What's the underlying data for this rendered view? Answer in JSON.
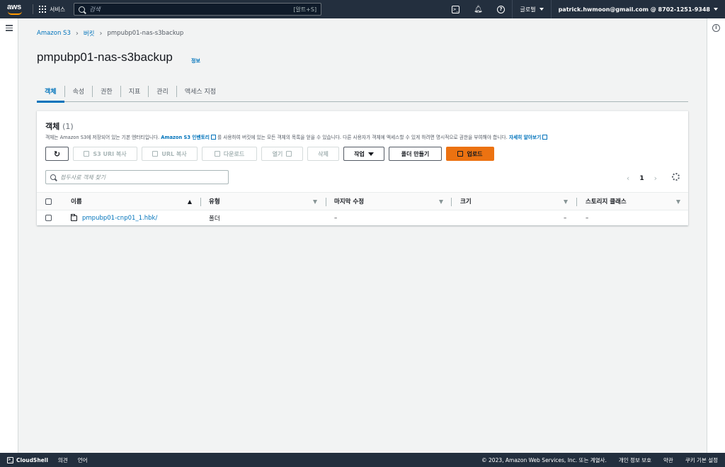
{
  "topnav": {
    "logo": "aws",
    "services_label": "서비스",
    "search_placeholder": "검색",
    "search_shortcut": "[알트+S]",
    "region_label": "글로벌",
    "account_label": "patrick.hwmoon@gmail.com @ 8702-1251-9348",
    "icons": [
      "grid-icon",
      "search-icon",
      "cloudshell-icon",
      "bell-icon",
      "help-icon"
    ]
  },
  "breadcrumb": {
    "items": [
      "Amazon S3",
      "버킷",
      "pmpubp01-nas-s3backup"
    ]
  },
  "page": {
    "title": "pmpubp01-nas-s3backup",
    "info_link": "정보"
  },
  "tabs": [
    {
      "label": "객체",
      "active": true
    },
    {
      "label": "속성",
      "active": false
    },
    {
      "label": "권한",
      "active": false
    },
    {
      "label": "지표",
      "active": false
    },
    {
      "label": "관리",
      "active": false
    },
    {
      "label": "액세스 지점",
      "active": false
    }
  ],
  "objects_panel": {
    "heading": "객체",
    "count": "(1)",
    "desc_1": "객체는 Amazon S3에 저장되어 있는 기본 엔터티입니다.",
    "desc_link_1": "Amazon S3 인벤토리",
    "desc_2": "를 사용하여 버킷에 있는 모든 객체의 목록을 얻을 수 있습니다. 다른 사용자가 객체에 액세스할 수 있게 하려면 명시적으로 권한을 부여해야 합니다.",
    "desc_link_2": "자세히 알아보기",
    "buttons": {
      "copy_s3_uri": "S3 URI 복사",
      "copy_url": "URL 복사",
      "download": "다운로드",
      "open": "열기",
      "delete": "삭제",
      "actions": "작업",
      "create_folder": "폴더 만들기",
      "upload": "업로드"
    },
    "filter_placeholder": "접두사로 객체 찾기",
    "page_number": "1",
    "columns": [
      "이름",
      "유형",
      "마지막 수정",
      "크기",
      "스토리지 클래스"
    ],
    "rows": [
      {
        "name": "pmpubp01-cnp01_1.hbk/",
        "type": "폴더",
        "last_modified": "–",
        "size": "–",
        "storage_class": "–"
      }
    ]
  },
  "footer": {
    "cloudshell": "CloudShell",
    "feedback": "의견",
    "language": "언어",
    "copyright": "© 2023, Amazon Web Services, Inc. 또는 계열사.",
    "privacy": "개인 정보 보호",
    "terms": "약관",
    "cookie": "쿠키 기본 설정"
  },
  "colors": {
    "nav_bg": "#232f3e",
    "link": "#0073bb",
    "primary": "#ec7211"
  }
}
